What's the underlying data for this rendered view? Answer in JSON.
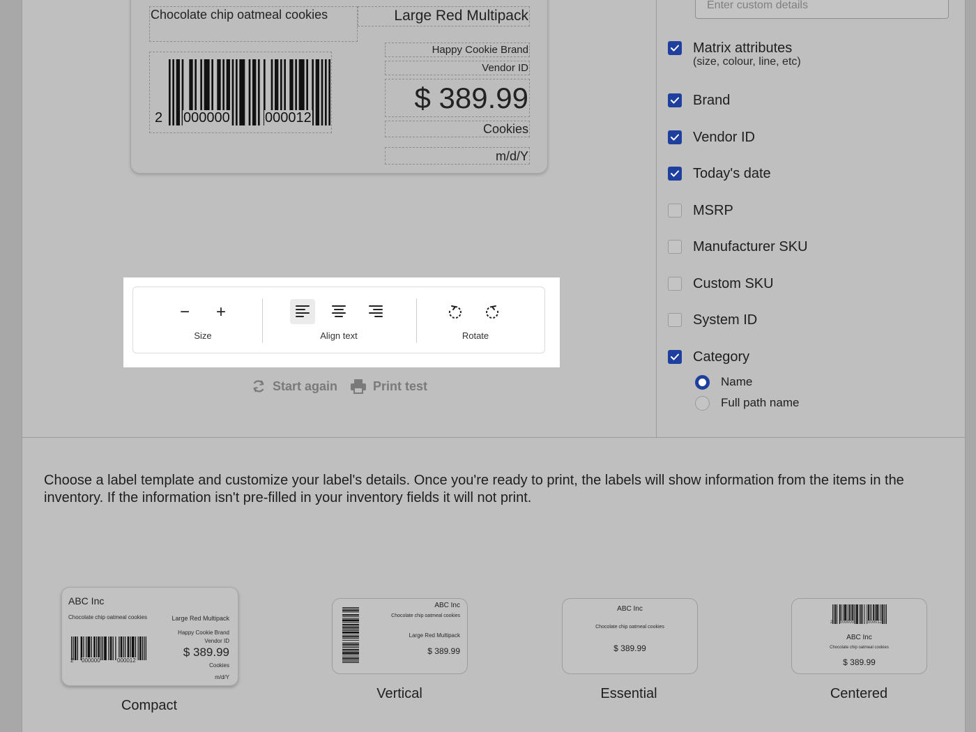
{
  "label_preview": {
    "description": "Chocolate chip oatmeal cookies",
    "variant": "Large Red Multipack",
    "brand": "Happy Cookie Brand",
    "vendor_id": "Vendor ID",
    "price": "$ 389.99",
    "category": "Cookies",
    "date_format": "m/d/Y",
    "barcode": {
      "prefix": "2",
      "left_group": "000000",
      "right_group": "000012"
    }
  },
  "toolbar": {
    "size_label": "Size",
    "align_label": "Align text",
    "rotate_label": "Rotate",
    "decrease_symbol": "−",
    "increase_symbol": "+",
    "active_alignment": "left"
  },
  "actions": {
    "start_again": "Start again",
    "print_test": "Print test"
  },
  "sidebar": {
    "custom_details_placeholder": "Enter custom details",
    "options": [
      {
        "label": "Matrix attributes",
        "sublabel": "(size, colour, line, etc)",
        "checked": true
      },
      {
        "label": "Brand",
        "checked": true
      },
      {
        "label": "Vendor ID",
        "checked": true
      },
      {
        "label": "Today's date",
        "checked": true
      },
      {
        "label": "MSRP",
        "checked": false
      },
      {
        "label": "Manufacturer SKU",
        "checked": false
      },
      {
        "label": "Custom SKU",
        "checked": false
      },
      {
        "label": "System ID",
        "checked": false
      },
      {
        "label": "Category",
        "checked": true
      }
    ],
    "category_mode": [
      {
        "label": "Name",
        "selected": true
      },
      {
        "label": "Full path name",
        "selected": false
      }
    ]
  },
  "intro_text": "Choose a label template and customize your label's details. Once you're ready to print, the labels will show information from the items in the inventory. If the information isn't pre-filled in your inventory fields it will not print.",
  "templates": {
    "selected": "Compact",
    "company": "ABC Inc",
    "description": "Chocolate chip oatmeal cookies",
    "variant": "Large Red Multipack",
    "brand": "Happy Cookie Brand",
    "vendor_id": "Vendor ID",
    "price": "$ 389.99",
    "category": "Cookies",
    "date_format": "m/d/Y",
    "barcode_prefix": "2",
    "barcode_left": "000000",
    "barcode_right": "000012",
    "names": [
      "Compact",
      "Vertical",
      "Essential",
      "Centered"
    ]
  },
  "colors": {
    "checkbox_checked": "#1f3f9e",
    "overlay_gray": "#bfbfbf",
    "toolbar_bg": "#ffffff"
  }
}
